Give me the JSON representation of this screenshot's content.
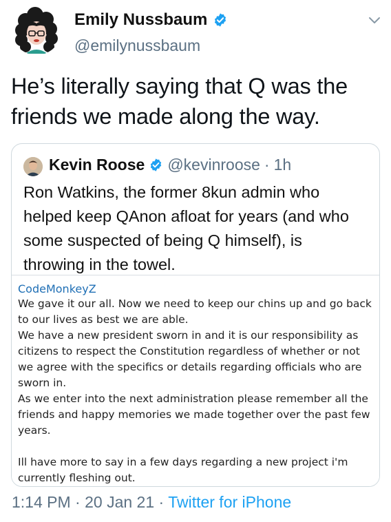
{
  "author": {
    "name": "Emily Nussbaum",
    "handle": "@emilynussbaum"
  },
  "tweet": {
    "text": "He’s literally saying that Q was the friends we made along the way."
  },
  "quoted": {
    "name": "Kevin Roose",
    "handle": "@kevinroose",
    "separator": "·",
    "time": "1h",
    "text": "Ron Watkins, the former 8kun admin who helped keep QAnon afloat for years (and who some suspected of being Q himself), is throwing in the towel.",
    "screenshot": {
      "username": "CodeMonkeyZ",
      "paragraphs": [
        "We gave it our all. Now we need to keep our chins up and go back to our lives as best we are able.",
        "We have a new president sworn in and it is our responsibility as citizens to respect the Constitution regardless of whether or not we agree with the specifics or details regarding officials who are sworn in.",
        "As we enter into the next administration please remember all the friends and happy memories we made together over the past few years.",
        " ",
        "Ill have more to say in a few days regarding a new project i'm currently fleshing out."
      ]
    }
  },
  "meta": {
    "time": "1:14 PM",
    "separator1": "·",
    "date": "20 Jan 21",
    "separator2": "·",
    "source": "Twitter for iPhone"
  },
  "colors": {
    "link": "#1da1f2",
    "muted": "#5b7083",
    "verified": "#1da1f2",
    "screenshot_username": "#1f6fb5"
  },
  "icons": {
    "verified": "verified-badge-icon",
    "menu": "chevron-down-icon"
  }
}
